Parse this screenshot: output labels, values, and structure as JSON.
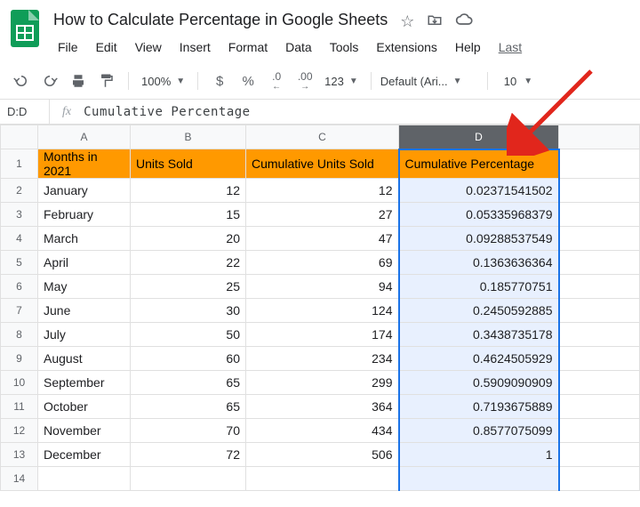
{
  "doc": {
    "title": "How to Calculate Percentage in Google Sheets"
  },
  "menu": {
    "file": "File",
    "edit": "Edit",
    "view": "View",
    "insert": "Insert",
    "format": "Format",
    "data": "Data",
    "tools": "Tools",
    "extensions": "Extensions",
    "help": "Help",
    "last": "Last"
  },
  "toolbar": {
    "zoom": "100%",
    "currency": "$",
    "percent": "%",
    "dec_dec": ".0",
    "inc_dec": ".00",
    "more_formats": "123",
    "font": "Default (Ari...",
    "font_size": "10"
  },
  "namebox": {
    "ref": "D:D",
    "formula": "Cumulative Percentage"
  },
  "columns": {
    "a": "A",
    "b": "B",
    "c": "C",
    "d": "D"
  },
  "headers": {
    "a": "Months in 2021",
    "b": "Units Sold",
    "c": "Cumulative Units Sold",
    "d": "Cumulative Percentage"
  },
  "rows": [
    {
      "n": "1"
    },
    {
      "n": "2",
      "a": "January",
      "b": "12",
      "c": "12",
      "d": "0.02371541502"
    },
    {
      "n": "3",
      "a": "February",
      "b": "15",
      "c": "27",
      "d": "0.05335968379"
    },
    {
      "n": "4",
      "a": "March",
      "b": "20",
      "c": "47",
      "d": "0.09288537549"
    },
    {
      "n": "5",
      "a": "April",
      "b": "22",
      "c": "69",
      "d": "0.1363636364"
    },
    {
      "n": "6",
      "a": "May",
      "b": "25",
      "c": "94",
      "d": "0.185770751"
    },
    {
      "n": "7",
      "a": "June",
      "b": "30",
      "c": "124",
      "d": "0.2450592885"
    },
    {
      "n": "8",
      "a": "July",
      "b": "50",
      "c": "174",
      "d": "0.3438735178"
    },
    {
      "n": "9",
      "a": "August",
      "b": "60",
      "c": "234",
      "d": "0.4624505929"
    },
    {
      "n": "10",
      "a": "September",
      "b": "65",
      "c": "299",
      "d": "0.5909090909"
    },
    {
      "n": "11",
      "a": "October",
      "b": "65",
      "c": "364",
      "d": "0.7193675889"
    },
    {
      "n": "12",
      "a": "November",
      "b": "70",
      "c": "434",
      "d": "0.8577075099"
    },
    {
      "n": "13",
      "a": "December",
      "b": "72",
      "c": "506",
      "d": "1"
    },
    {
      "n": "14",
      "a": "",
      "b": "",
      "c": "",
      "d": ""
    }
  ]
}
